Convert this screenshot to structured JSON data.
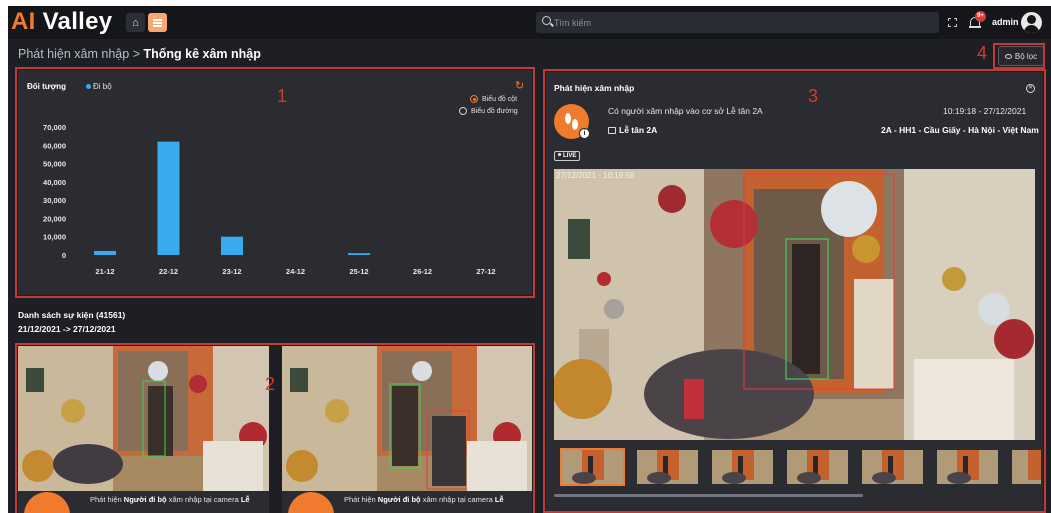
{
  "header": {
    "logo_ai": "AI",
    "logo_valley": "Valley",
    "search_placeholder": "Tìm kiếm",
    "notification_badge": "9+",
    "user_name": "admin"
  },
  "breadcrumb": {
    "parent": "Phát hiện xâm nhập",
    "separator": ">",
    "current": "Thống kê xâm nhập"
  },
  "filter_button": {
    "label": "Bộ lọc"
  },
  "markers": [
    "1",
    "2",
    "3",
    "4"
  ],
  "chart_panel": {
    "title": "Đối tượng",
    "legend": "Đi bộ",
    "options": [
      {
        "label": "Biểu đồ cột",
        "selected": true
      },
      {
        "label": "Biểu đồ đường",
        "selected": false
      }
    ]
  },
  "chart_data": {
    "type": "bar",
    "categories": [
      "21-12",
      "22-12",
      "23-12",
      "24-12",
      "25-12",
      "26-12",
      "27-12"
    ],
    "series": [
      {
        "name": "Đi bộ",
        "values": [
          2200,
          62000,
          10000,
          0,
          1000,
          0,
          0
        ]
      }
    ],
    "yticks": [
      "70,000",
      "60,000",
      "50,000",
      "40,000",
      "30,000",
      "20,000",
      "10,000",
      "0"
    ],
    "ylim": [
      0,
      70000
    ],
    "bar_color": "#3aaaf0",
    "legend_position": "top-left"
  },
  "event_list": {
    "title": "Danh sách sự kiện (41561)",
    "date_range": "21/12/2021 -> 27/12/2021",
    "cards": [
      {
        "caption_prefix": "Phát hiện ",
        "caption_bold": "Người đi bộ",
        "caption_suffix": " xâm nhập tại camera ",
        "caption_bold2": "Lễ"
      },
      {
        "caption_prefix": "Phát hiện ",
        "caption_bold": "Người đi bộ",
        "caption_suffix": " xâm nhập tại camera ",
        "caption_bold2": "Lễ"
      }
    ]
  },
  "detail_panel": {
    "title": "Phát hiện xâm nhập",
    "message": "Có người xâm nhập vào cơ sở Lễ tân 2A",
    "timestamp": "10:19:18 - 27/12/2021",
    "camera": "Lễ tân 2A",
    "location": "2A - HH1 - Cầu Giấy - Hà Nội - Việt Nam",
    "live_label": "LIVE",
    "video_timestamp": "27/12/2021 - 10:19:58"
  },
  "colors": {
    "accent": "#f07a2d",
    "bar": "#3aaaf0",
    "annotation": "#c23a35"
  }
}
